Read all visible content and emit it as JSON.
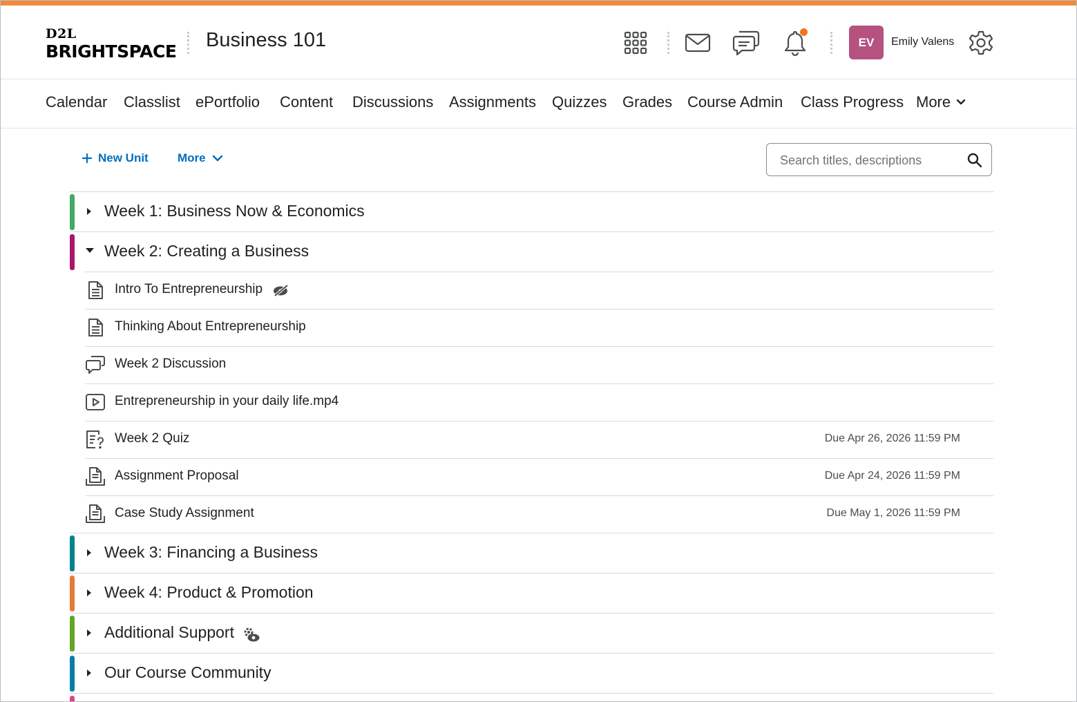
{
  "colors": {
    "top_accent": "#f18a3c",
    "link_blue": "#006fbf",
    "avatar_bg": "#b5527f",
    "notification_dot": "#f07421"
  },
  "header": {
    "logo_top": "D2L",
    "logo_main": "BRIGHTSPACE",
    "course_title": "Business 101",
    "icons": [
      "waffle-grid-icon",
      "mail-icon",
      "chat-icon",
      "bell-icon",
      "gear-icon"
    ],
    "user": {
      "initials": "EV",
      "name": "Emily Valens"
    }
  },
  "nav": {
    "items": [
      "Calendar",
      "Classlist",
      "ePortfolio",
      "Content",
      "Discussions",
      "Assignments",
      "Quizzes",
      "Grades",
      "Course Admin",
      "Class Progress"
    ],
    "more_label": "More"
  },
  "toolbar": {
    "new_unit_label": "New Unit",
    "more_label": "More",
    "search_placeholder": "Search titles, descriptions"
  },
  "units": [
    {
      "title": "Week 1: Business Now & Economics",
      "color": "#45a868",
      "expanded": false
    },
    {
      "title": "Week 2: Creating a Business",
      "color": "#a9166f",
      "expanded": true,
      "topics": [
        {
          "title": "Intro To Entrepreneurship",
          "icon": "document-icon",
          "hidden": true,
          "due": ""
        },
        {
          "title": "Thinking About Entrepreneurship",
          "icon": "document-icon",
          "due": ""
        },
        {
          "title": "Week 2 Discussion",
          "icon": "discussion-icon",
          "due": ""
        },
        {
          "title": "Entrepreneurship in your daily life.mp4",
          "icon": "video-icon",
          "due": ""
        },
        {
          "title": "Week 2 Quiz",
          "icon": "quiz-icon",
          "due": "Due Apr 26, 2026 11:59 PM"
        },
        {
          "title": "Assignment Proposal",
          "icon": "assignment-icon",
          "due": "Due Apr 24, 2026 11:59 PM"
        },
        {
          "title": "Case Study Assignment",
          "icon": "assignment-icon",
          "due": "Due May 1, 2026 11:59 PM"
        }
      ]
    },
    {
      "title": "Week 3: Financing a Business",
      "color": "#00838a",
      "expanded": false
    },
    {
      "title": "Week 4: Product & Promotion",
      "color": "#e87a38",
      "expanded": false
    },
    {
      "title": "Additional Support",
      "color": "#63a427",
      "expanded": false,
      "extra_icon": "release-conditions-icon"
    },
    {
      "title": "Our Course Community",
      "color": "#0a7fa6",
      "expanded": false
    }
  ],
  "peek_unit_color": "#e2418f"
}
